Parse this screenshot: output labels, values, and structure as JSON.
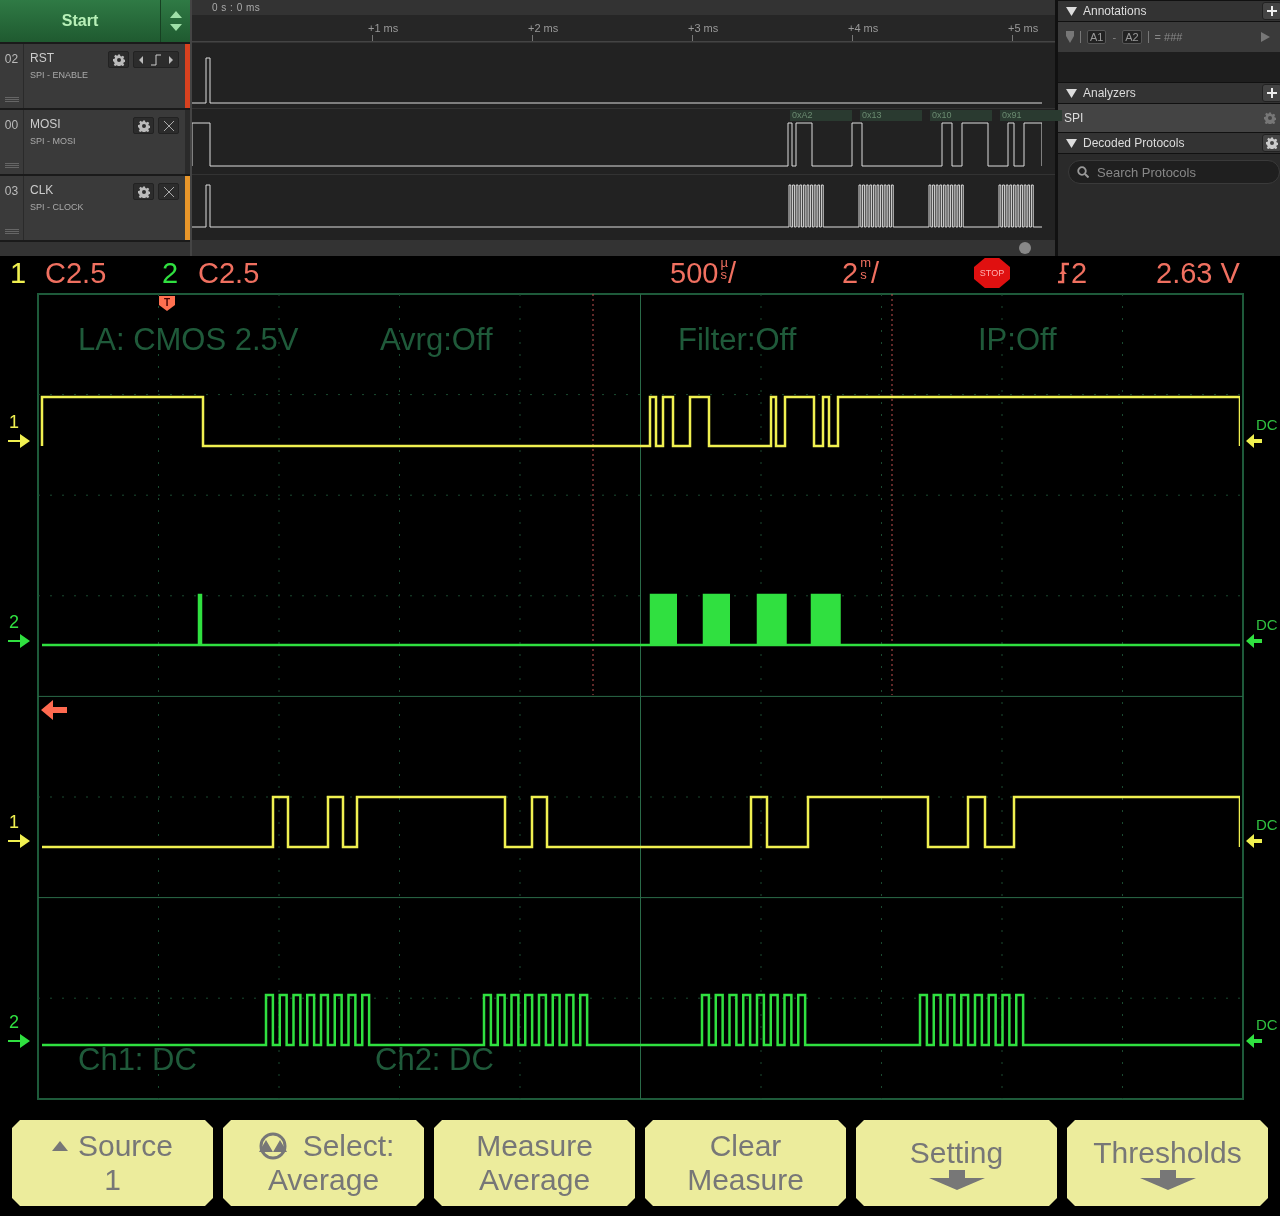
{
  "start_button": "Start",
  "channels": [
    {
      "number": "02",
      "name": "RST",
      "subtitle": "SPI - ENABLE",
      "color": "#d8411f",
      "kind": "trigger"
    },
    {
      "number": "00",
      "name": "MOSI",
      "subtitle": "SPI - MOSI",
      "color": "#2a2a2a",
      "kind": "removable",
      "decoded": [
        "0xA2",
        "0x13",
        "0x10",
        "0x91"
      ]
    },
    {
      "number": "03",
      "name": "CLK",
      "subtitle": "SPI - CLOCK",
      "color": "#e8962a",
      "kind": "removable"
    }
  ],
  "timeline": {
    "origin": "0 s : 0 ms",
    "ticks": [
      "+1 ms",
      "+2 ms",
      "+3 ms",
      "+4 ms",
      "+5 ms"
    ]
  },
  "annotations": {
    "title": "Annotations",
    "marker_a": "A1",
    "separator": "-",
    "marker_b": "A2",
    "result": "= ###"
  },
  "analyzers": {
    "title": "Analyzers",
    "items": [
      "SPI"
    ]
  },
  "decoded_protocols": {
    "title": "Decoded Protocols",
    "search": {
      "placeholder": "Search Protocols"
    }
  },
  "scope": {
    "header": {
      "ch1_number": "1",
      "ch1_scale": "C2.5",
      "ch2_number": "2",
      "ch2_scale": "C2.5",
      "timebase": {
        "value": "500",
        "unit_top": "µ",
        "unit_bottom": "s",
        "slash": "/"
      },
      "delay": {
        "value": "2",
        "unit_top": "m",
        "unit_bottom": "s",
        "slash": "/"
      },
      "run_state": "STOP",
      "trigger_source": "2",
      "trigger_level": "2.63 V"
    },
    "trigger_marker": "T",
    "overlays": [
      "LA: CMOS 2.5V",
      "Avrg:Off",
      "Filter:Off",
      "IP:Off",
      "Ch1: DC",
      "Ch2: DC"
    ],
    "traces": [
      {
        "label": "1",
        "color": "#f0f050",
        "coupling": "DC"
      },
      {
        "label": "2",
        "color": "#30e040",
        "coupling": "DC"
      },
      {
        "label": "1",
        "color": "#f0f050",
        "coupling": "DC"
      },
      {
        "label": "2",
        "color": "#30e040",
        "coupling": "DC"
      }
    ],
    "softkeys": [
      {
        "lines": [
          "Source",
          "1"
        ],
        "kind": "source"
      },
      {
        "lines": [
          "Select:",
          "Average"
        ],
        "kind": "select"
      },
      {
        "lines": [
          "Measure",
          "Average"
        ],
        "kind": "action"
      },
      {
        "lines": [
          "Clear",
          "Measure"
        ],
        "kind": "action"
      },
      {
        "lines": [
          "Setting"
        ],
        "kind": "menu"
      },
      {
        "lines": [
          "Thresholds"
        ],
        "kind": "menu"
      }
    ]
  }
}
